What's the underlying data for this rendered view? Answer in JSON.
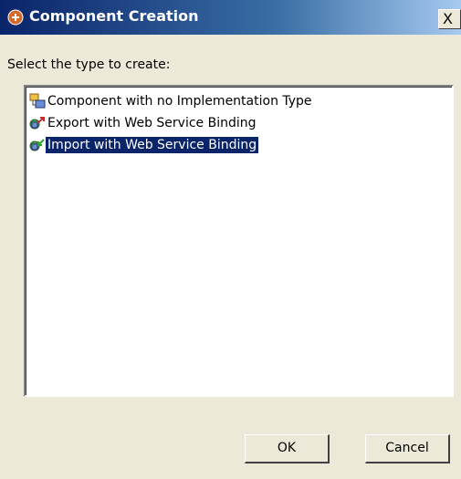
{
  "window": {
    "title": "Component Creation",
    "title_icon": "component-creation-icon",
    "close_label": "X"
  },
  "prompt": "Select the type to create:",
  "list": {
    "items": [
      {
        "label": "Component with no Implementation Type",
        "icon": "component-icon",
        "selected": false
      },
      {
        "label": "Export with Web Service Binding",
        "icon": "export-icon",
        "selected": false
      },
      {
        "label": "Import with Web Service Binding",
        "icon": "import-icon",
        "selected": true
      }
    ]
  },
  "buttons": {
    "ok_label": "OK",
    "cancel_label": "Cancel"
  },
  "colors": {
    "selection": "#0a246a",
    "dialog_bg": "#ece9d8",
    "title_gradient_start": "#0a246a"
  }
}
